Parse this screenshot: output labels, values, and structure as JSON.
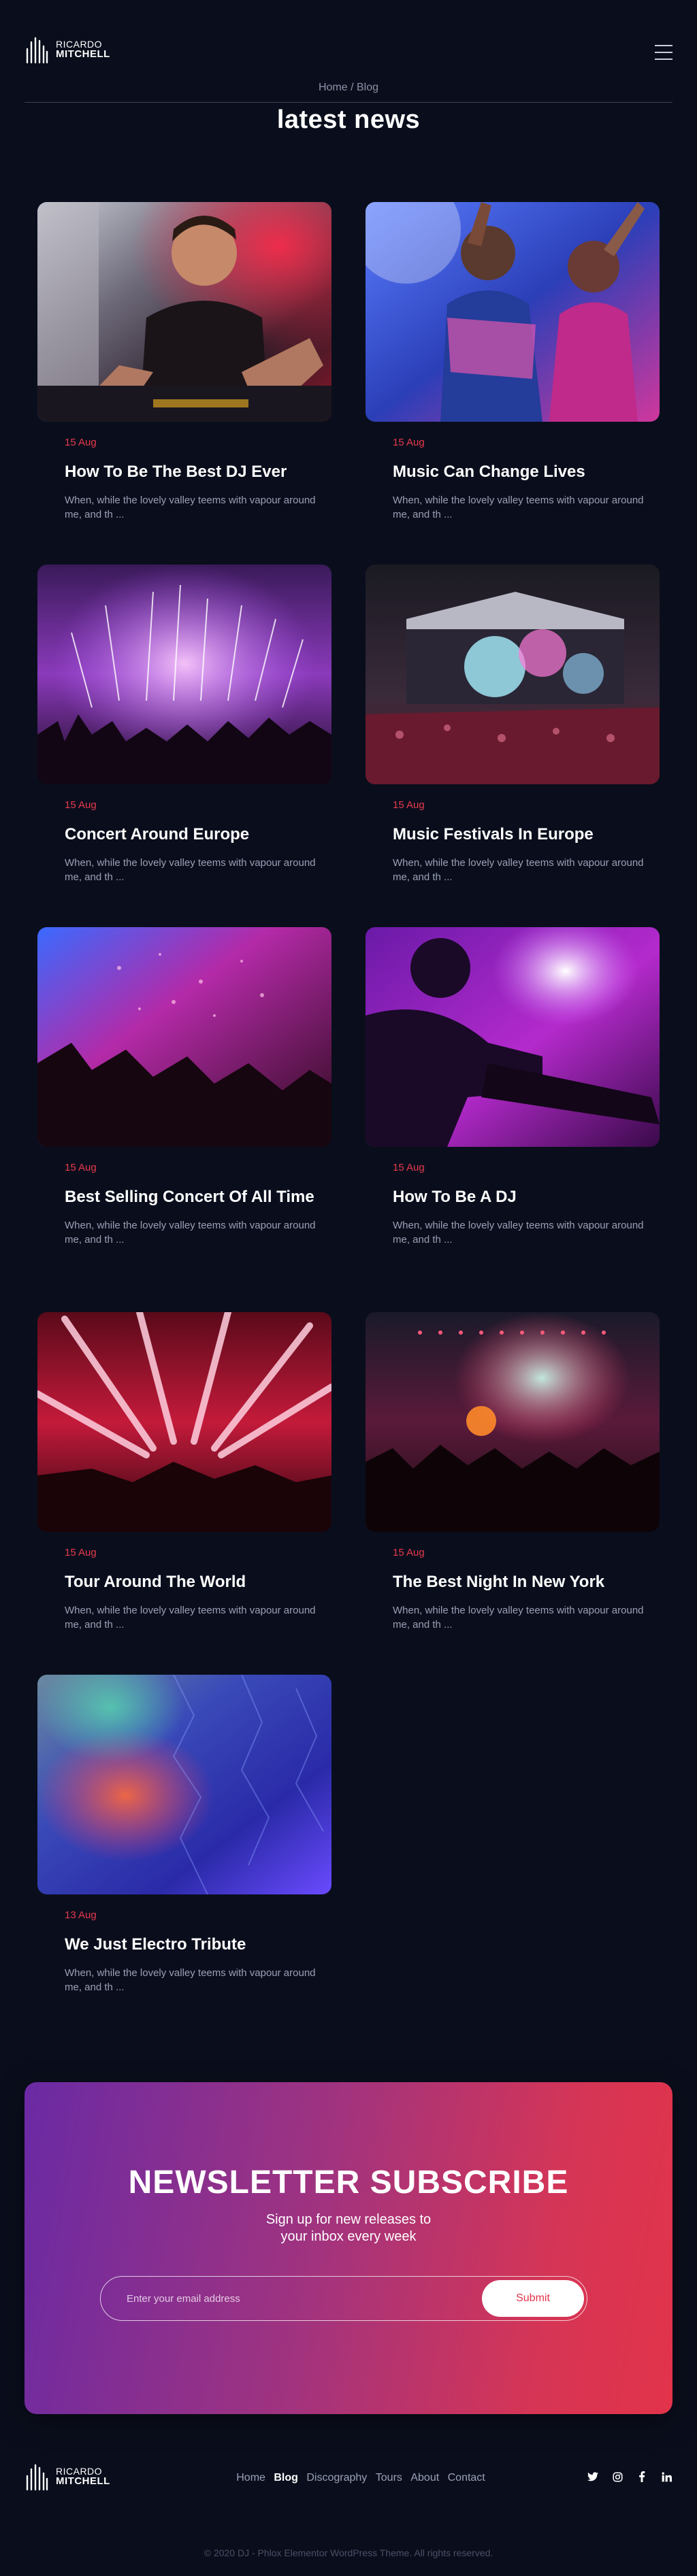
{
  "brand": {
    "first": "RICARDO",
    "last": "MITCHELL"
  },
  "breadcrumb": {
    "home": "Home",
    "separator": " / ",
    "current": "Blog"
  },
  "page_title": "latest news",
  "accent_color": "#e8394e",
  "posts": [
    {
      "date": "15 Aug",
      "title": "How To Be The Best DJ Ever",
      "excerpt": "When, while the lovely valley teems with vapour around me, and th ..."
    },
    {
      "date": "15 Aug",
      "title": "Music Can Change Lives",
      "excerpt": "When, while the lovely valley teems with vapour around me, and th ..."
    },
    {
      "date": "15 Aug",
      "title": "Concert Around Europe",
      "excerpt": "When, while the lovely valley teems with vapour around me, and th ..."
    },
    {
      "date": "15 Aug",
      "title": "Music Festivals In Europe",
      "excerpt": "When, while the lovely valley teems with vapour around me, and th ..."
    },
    {
      "date": "15 Aug",
      "title": "Best Selling Concert Of All Time",
      "excerpt": "When, while the lovely valley teems with vapour around me, and th ..."
    },
    {
      "date": "15 Aug",
      "title": "How To Be A DJ",
      "excerpt": "When, while the lovely valley teems with vapour around me, and th ..."
    },
    {
      "date": "15 Aug",
      "title": "Tour Around The World",
      "excerpt": "When, while the lovely valley teems with vapour around me, and th ..."
    },
    {
      "date": "15 Aug",
      "title": "The Best Night In New York",
      "excerpt": "When, while the lovely valley teems with vapour around me, and th ..."
    },
    {
      "date": "13 Aug",
      "title": "We Just Electro Tribute",
      "excerpt": "When, while the lovely valley teems with vapour around me, and th ..."
    }
  ],
  "newsletter": {
    "title": "NEWSLETTER SUBSCRIBE",
    "subtitle_line1": "Sign up for new releases to",
    "subtitle_line2": "your inbox every week",
    "placeholder": "Enter your email address",
    "submit_label": "Submit"
  },
  "footer": {
    "nav": [
      "Home",
      "Blog",
      "Discography",
      "Tours",
      "About",
      "Contact"
    ],
    "active": "Blog",
    "socials": [
      "twitter-icon",
      "instagram-icon",
      "facebook-icon",
      "linkedin-icon"
    ],
    "copyright": "© 2020 DJ - Phlox Elementor WordPress Theme. All rights reserved."
  }
}
